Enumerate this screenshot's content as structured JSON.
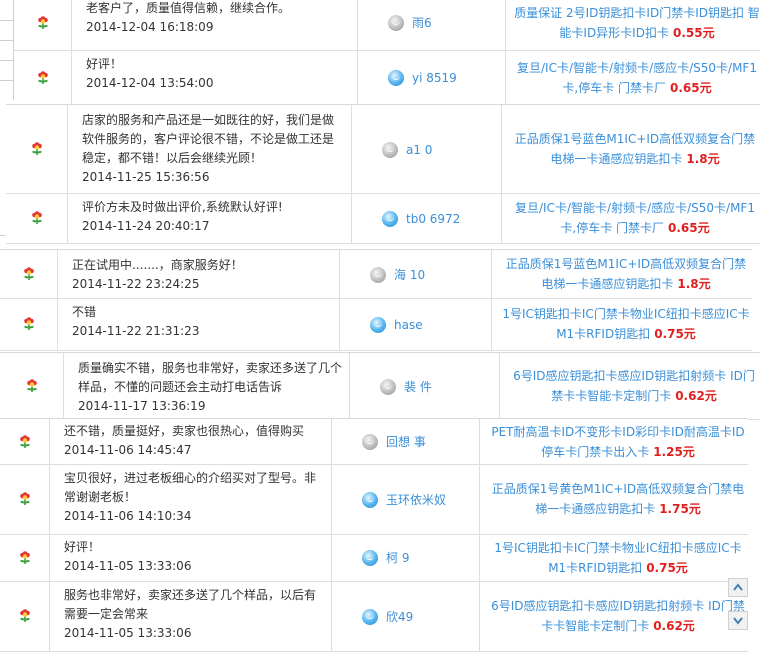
{
  "rows": [
    {
      "comment": "老客户了，质量值得信赖，继续合作。",
      "date": "2014-12-04 16:18:09",
      "user_visible": "雨6",
      "avatar": "grey",
      "product": "质量保证 2号ID钥匙扣卡ID门禁卡ID钥匙扣 智能卡ID异形卡ID扣卡",
      "price": "0.55元"
    },
    {
      "comment": "好评！",
      "date": "2014-12-04 13:54:00",
      "user_visible": "yi 8519",
      "avatar": "blue",
      "product": "复旦/IC卡/智能卡/射频卡/感应卡/S50卡/MF1卡,停车卡 门禁卡厂",
      "price": "0.65元"
    },
    {
      "comment": "店家的服务和产品还是一如既往的好，我们是做软件服务的，客户评论很不错，不论是做工还是稳定，都不错！以后会继续光顾！",
      "date": "2014-11-25 15:36:56",
      "user_visible": "a1 0",
      "avatar": "grey",
      "product": "正品质保1号蓝色M1IC+ID高低双频复合门禁电梯一卡通感应钥匙扣卡",
      "price": "1.8元"
    },
    {
      "comment": "评价方未及时做出评价,系统默认好评!",
      "date": "2014-11-24 20:40:17",
      "user_visible": "tb0 6972",
      "avatar": "blue",
      "product": "复旦/IC卡/智能卡/射频卡/感应卡/S50卡/MF1卡,停车卡 门禁卡厂",
      "price": "0.65元"
    },
    {
      "comment": "正在试用中.......，商家服务好！",
      "date": "2014-11-22 23:24:25",
      "user_visible": "海 10",
      "avatar": "grey",
      "product": "正品质保1号蓝色M1IC+ID高低双频复合门禁电梯一卡通感应钥匙扣卡",
      "price": "1.8元"
    },
    {
      "comment": "不错",
      "date": "2014-11-22 21:31:23",
      "user_visible": "hase",
      "avatar": "blue",
      "product": "1号IC钥匙扣卡IC门禁卡物业IC纽扣卡感应IC卡M1卡RFID钥匙扣",
      "price": "0.75元"
    },
    {
      "comment": "质量确实不错，服务也非常好，卖家还多送了几个样品，不懂的问题还会主动打电话告诉",
      "date": "2014-11-17 13:36:19",
      "user_visible": "裴 件",
      "avatar": "grey",
      "product": "6号ID感应钥匙扣卡感应ID钥匙扣射频卡 ID门禁卡卡智能卡定制门卡",
      "price": "0.62元"
    },
    {
      "comment": "还不错，质量挺好，卖家也很热心，值得购买",
      "date": "2014-11-06 14:45:47",
      "user_visible": "回想 事",
      "avatar": "grey",
      "product": "PET耐高温卡ID不变形卡ID彩印卡ID耐高温卡ID停车卡门禁卡出入卡",
      "price": "1.25元"
    },
    {
      "comment": "宝贝很好，进过老板细心的介绍买对了型号。非常谢谢老板！",
      "date": "2014-11-06 14:10:34",
      "user_visible": "玉环依米奴",
      "avatar": "blue",
      "product": "正品质保1号黄色M1IC+ID高低双频复合门禁电梯一卡通感应钥匙扣卡",
      "price": "1.75元"
    },
    {
      "comment": "好评！",
      "date": "2014-11-05 13:33:06",
      "user_visible": "柯 9",
      "avatar": "blue",
      "product": "1号IC钥匙扣卡IC门禁卡物业IC纽扣卡感应IC卡M1卡RFID钥匙扣",
      "price": "0.75元"
    },
    {
      "comment": "服务也非常好，卖家还多送了几个样品，以后有需要一定会常来",
      "date": "2014-11-05 13:33:06",
      "user_visible": "欣49",
      "avatar": "blue",
      "product": "6号ID感应钥匙扣卡感应ID钥匙扣射频卡 ID门禁卡卡智能卡定制门卡",
      "price": "0.62元"
    }
  ],
  "colors": {
    "link": "#3a8fd8",
    "price": "#e21f1f",
    "flower_red": "#e53434",
    "flower_green": "#3aa03a"
  },
  "icons": {
    "flower": "flower-icon",
    "avatar": "user-avatar-icon",
    "scroll_up": "chevron-up-icon",
    "scroll_down": "chevron-down-icon"
  }
}
